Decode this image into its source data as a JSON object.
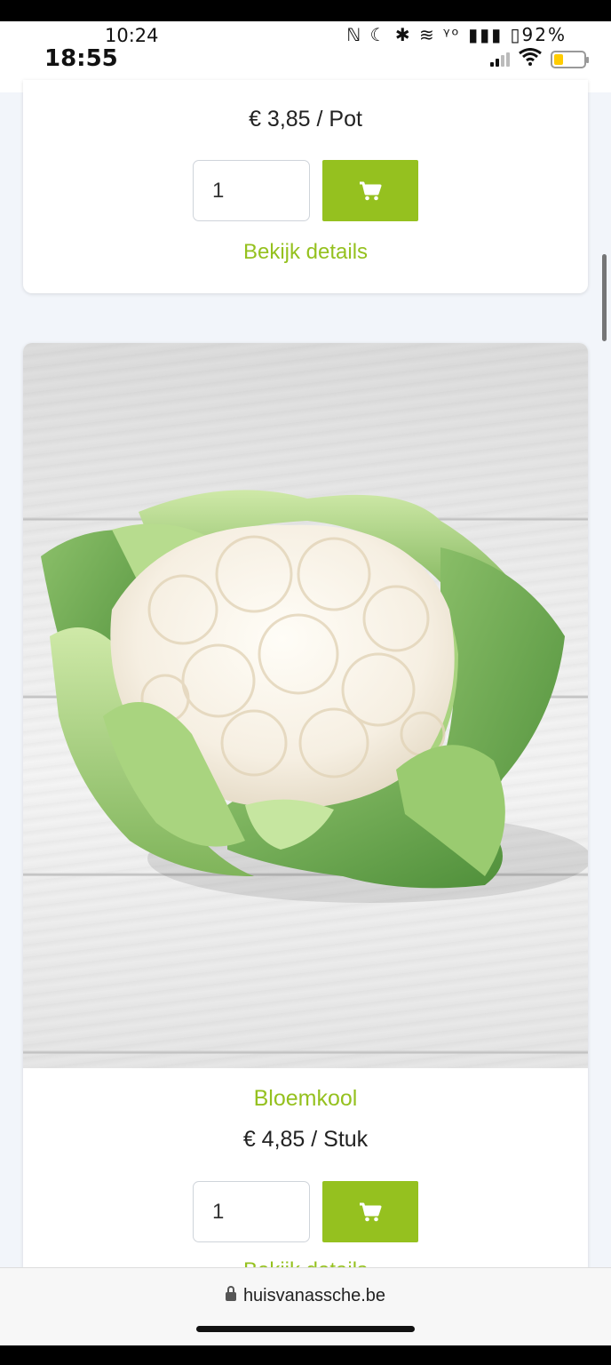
{
  "status_bar": {
    "outer_time": "10:24",
    "outer_icons": "ℕ ☾ ✱ ≋ ᵞᵒ ▮▮▮ ▯92%",
    "inner_time": "18:55",
    "battery_level": 0.3,
    "battery_color": "#ffcc00"
  },
  "products": [
    {
      "price": "€ 3,85 / Pot",
      "quantity": "1",
      "details_label": "Bekijk details"
    },
    {
      "name": "Bloemkool",
      "price": "€ 4,85 / Stuk",
      "quantity": "1",
      "details_label": "Bekijk details"
    }
  ],
  "browser": {
    "url": "huisvanassche.be"
  },
  "colors": {
    "accent": "#95c11f"
  },
  "icons": {
    "cart": "shopping-cart-icon",
    "lock": "lock-icon",
    "wifi": "wifi-icon",
    "battery": "battery-icon"
  }
}
